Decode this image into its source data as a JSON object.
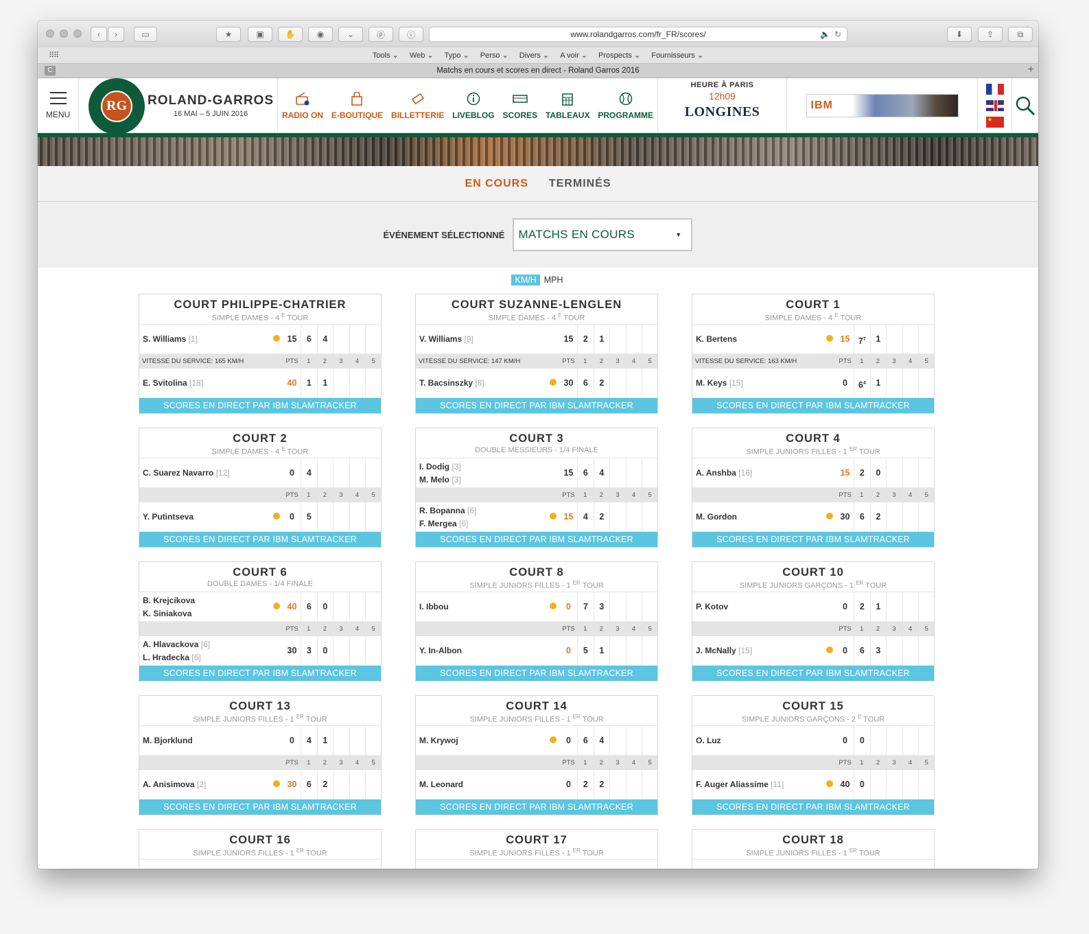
{
  "browser": {
    "url": "www.rolandgarros.com/fr_FR/scores/",
    "tab_title": "Matchs en cours et scores en direct - Roland Garros 2016",
    "bookmarks": [
      "Tools",
      "Web",
      "Typo",
      "Perso",
      "Divers",
      "A voir",
      "Prospects",
      "Fournisseurs"
    ]
  },
  "header": {
    "menu_label": "MENU",
    "brand": "ROLAND-GARROS",
    "dates": "16 MAI – 5 JUIN 2016",
    "nav": [
      "RADIO ON",
      "E-BOUTIQUE",
      "BILLETTERIE",
      "LIVEBLOG",
      "SCORES",
      "TABLEAUX",
      "PROGRAMME"
    ],
    "hour_title": "HEURE À PARIS",
    "hour": "12h09",
    "sponsor": "LONGINES",
    "ad_brand": "IBM"
  },
  "tabs": {
    "active": "EN COURS",
    "other": "TERMINÉS"
  },
  "event": {
    "label": "ÉVÉNEMENT SÉLECTIONNÉ",
    "selected": "MATCHS EN COURS"
  },
  "units": {
    "on": "KM/H",
    "off": "MPH"
  },
  "button_label": "SCORES EN DIRECT PAR IBM SLAMTRACKER",
  "pts_label": "PTS",
  "set_numbers": [
    "1",
    "2",
    "3",
    "4",
    "5"
  ],
  "courts": [
    {
      "name": "COURT PHILIPPE-CHATRIER",
      "sub": "SIMPLE DAMES - 4",
      "sup": "E",
      "tour": "TOUR",
      "speed": "VITESSE DU SERVICE: 165 KM/H",
      "p1": {
        "names": [
          {
            "n": "S. Williams",
            "s": "[1]"
          }
        ],
        "serve": true,
        "pts": "15",
        "pts_or": false,
        "sets": [
          "6",
          "4"
        ]
      },
      "p2": {
        "names": [
          {
            "n": "E. Svitolina",
            "s": "[18]"
          }
        ],
        "serve": false,
        "pts": "40",
        "pts_or": true,
        "sets": [
          "1",
          "1"
        ]
      }
    },
    {
      "name": "COURT SUZANNE-LENGLEN",
      "sub": "SIMPLE DAMES - 4",
      "sup": "E",
      "tour": "TOUR",
      "speed": "VITESSE DU SERVICE: 147 KM/H",
      "p1": {
        "names": [
          {
            "n": "V. Williams",
            "s": "[9]"
          }
        ],
        "serve": false,
        "pts": "15",
        "pts_or": false,
        "sets": [
          "2",
          "1"
        ]
      },
      "p2": {
        "names": [
          {
            "n": "T. Bacsinszky",
            "s": "[8]"
          }
        ],
        "serve": true,
        "pts": "30",
        "pts_or": false,
        "sets": [
          "6",
          "2"
        ]
      }
    },
    {
      "name": "COURT 1",
      "sub": "SIMPLE DAMES - 4",
      "sup": "E",
      "tour": "TOUR",
      "speed": "VITESSE DU SERVICE: 163 KM/H",
      "p1": {
        "names": [
          {
            "n": "K. Bertens",
            "s": ""
          }
        ],
        "serve": true,
        "pts": "15",
        "pts_or": true,
        "sets": [
          "77",
          "1"
        ]
      },
      "p2": {
        "names": [
          {
            "n": "M. Keys",
            "s": "[15]"
          }
        ],
        "serve": false,
        "pts": "0",
        "pts_or": false,
        "sets": [
          "64",
          "1"
        ]
      }
    },
    {
      "name": "COURT 2",
      "sub": "SIMPLE DAMES - 4",
      "sup": "E",
      "tour": "TOUR",
      "speed": "",
      "p1": {
        "names": [
          {
            "n": "C. Suarez Navarro",
            "s": "[12]"
          }
        ],
        "serve": false,
        "pts": "0",
        "pts_or": false,
        "sets": [
          "4"
        ]
      },
      "p2": {
        "names": [
          {
            "n": "Y. Putintseva",
            "s": ""
          }
        ],
        "serve": true,
        "pts": "0",
        "pts_or": false,
        "sets": [
          "5"
        ]
      }
    },
    {
      "name": "COURT 3",
      "sub": "DOUBLE MESSIEURS - 1/4 FINALE",
      "sup": "",
      "tour": "",
      "speed": "",
      "p1": {
        "names": [
          {
            "n": "I. Dodig",
            "s": "[3]"
          },
          {
            "n": "M. Melo",
            "s": "[3]"
          }
        ],
        "serve": false,
        "pts": "15",
        "pts_or": false,
        "sets": [
          "6",
          "4"
        ]
      },
      "p2": {
        "names": [
          {
            "n": "R. Bopanna",
            "s": "[6]"
          },
          {
            "n": "F. Mergea",
            "s": "[6]"
          }
        ],
        "serve": true,
        "pts": "15",
        "pts_or": true,
        "sets": [
          "4",
          "2"
        ]
      }
    },
    {
      "name": "COURT 4",
      "sub": "SIMPLE JUNIORS FILLES - 1",
      "sup": "ER",
      "tour": "TOUR",
      "speed": "",
      "p1": {
        "names": [
          {
            "n": "A. Anshba",
            "s": "[16]"
          }
        ],
        "serve": false,
        "pts": "15",
        "pts_or": true,
        "sets": [
          "2",
          "0"
        ]
      },
      "p2": {
        "names": [
          {
            "n": "M. Gordon",
            "s": ""
          }
        ],
        "serve": true,
        "pts": "30",
        "pts_or": false,
        "sets": [
          "6",
          "2"
        ]
      }
    },
    {
      "name": "COURT 6",
      "sub": "DOUBLE DAMES - 1/4 FINALE",
      "sup": "",
      "tour": "",
      "speed": "",
      "p1": {
        "names": [
          {
            "n": "B. Krejcikova",
            "s": ""
          },
          {
            "n": "K. Siniakova",
            "s": ""
          }
        ],
        "serve": true,
        "pts": "40",
        "pts_or": true,
        "sets": [
          "6",
          "0"
        ]
      },
      "p2": {
        "names": [
          {
            "n": "A. Hlavackova",
            "s": "[6]"
          },
          {
            "n": "L. Hradecka",
            "s": "[6]"
          }
        ],
        "serve": false,
        "pts": "30",
        "pts_or": false,
        "sets": [
          "3",
          "0"
        ]
      }
    },
    {
      "name": "COURT 8",
      "sub": "SIMPLE JUNIORS FILLES - 1",
      "sup": "ER",
      "tour": "TOUR",
      "speed": "",
      "p1": {
        "names": [
          {
            "n": "I. Ibbou",
            "s": ""
          }
        ],
        "serve": true,
        "pts": "0",
        "pts_or": true,
        "sets": [
          "7",
          "3"
        ]
      },
      "p2": {
        "names": [
          {
            "n": "Y. In-Albon",
            "s": ""
          }
        ],
        "serve": false,
        "pts": "0",
        "pts_or": true,
        "sets": [
          "5",
          "1"
        ]
      }
    },
    {
      "name": "COURT 10",
      "sub": "SIMPLE JUNIORS GARÇONS - 1",
      "sup": "ER",
      "tour": "TOUR",
      "speed": "",
      "p1": {
        "names": [
          {
            "n": "P. Kotov",
            "s": ""
          }
        ],
        "serve": false,
        "pts": "0",
        "pts_or": false,
        "sets": [
          "2",
          "1"
        ]
      },
      "p2": {
        "names": [
          {
            "n": "J. McNally",
            "s": "[15]"
          }
        ],
        "serve": true,
        "pts": "0",
        "pts_or": false,
        "sets": [
          "6",
          "3"
        ]
      }
    },
    {
      "name": "COURT 13",
      "sub": "SIMPLE JUNIORS FILLES - 1",
      "sup": "ER",
      "tour": "TOUR",
      "speed": "",
      "p1": {
        "names": [
          {
            "n": "M. Bjorklund",
            "s": ""
          }
        ],
        "serve": false,
        "pts": "0",
        "pts_or": false,
        "sets": [
          "4",
          "1"
        ]
      },
      "p2": {
        "names": [
          {
            "n": "A. Anisimova",
            "s": "[2]"
          }
        ],
        "serve": true,
        "pts": "30",
        "pts_or": true,
        "sets": [
          "6",
          "2"
        ]
      }
    },
    {
      "name": "COURT 14",
      "sub": "SIMPLE JUNIORS FILLES - 1",
      "sup": "ER",
      "tour": "TOUR",
      "speed": "",
      "p1": {
        "names": [
          {
            "n": "M. Krywoj",
            "s": ""
          }
        ],
        "serve": true,
        "pts": "0",
        "pts_or": false,
        "sets": [
          "6",
          "4"
        ]
      },
      "p2": {
        "names": [
          {
            "n": "M. Leonard",
            "s": ""
          }
        ],
        "serve": false,
        "pts": "0",
        "pts_or": false,
        "sets": [
          "2",
          "2"
        ]
      }
    },
    {
      "name": "COURT 15",
      "sub": "SIMPLE JUNIORS GARÇONS - 2",
      "sup": "E",
      "tour": "TOUR",
      "speed": "",
      "p1": {
        "names": [
          {
            "n": "O. Luz",
            "s": ""
          }
        ],
        "serve": false,
        "pts": "0",
        "pts_or": false,
        "sets": [
          "0"
        ]
      },
      "p2": {
        "names": [
          {
            "n": "F. Auger Aliassime",
            "s": "[11]"
          }
        ],
        "serve": true,
        "pts": "40",
        "pts_or": false,
        "sets": [
          "0"
        ]
      }
    }
  ],
  "courts_partial": [
    {
      "name": "COURT 16",
      "sub": "SIMPLE JUNIORS FILLES - 1",
      "sup": "ER",
      "tour": "TOUR"
    },
    {
      "name": "COURT 17",
      "sub": "SIMPLE JUNIORS FILLES - 1",
      "sup": "ER",
      "tour": "TOUR"
    },
    {
      "name": "COURT 18",
      "sub": "SIMPLE JUNIORS FILLES - 1",
      "sup": "ER",
      "tour": "TOUR"
    }
  ]
}
